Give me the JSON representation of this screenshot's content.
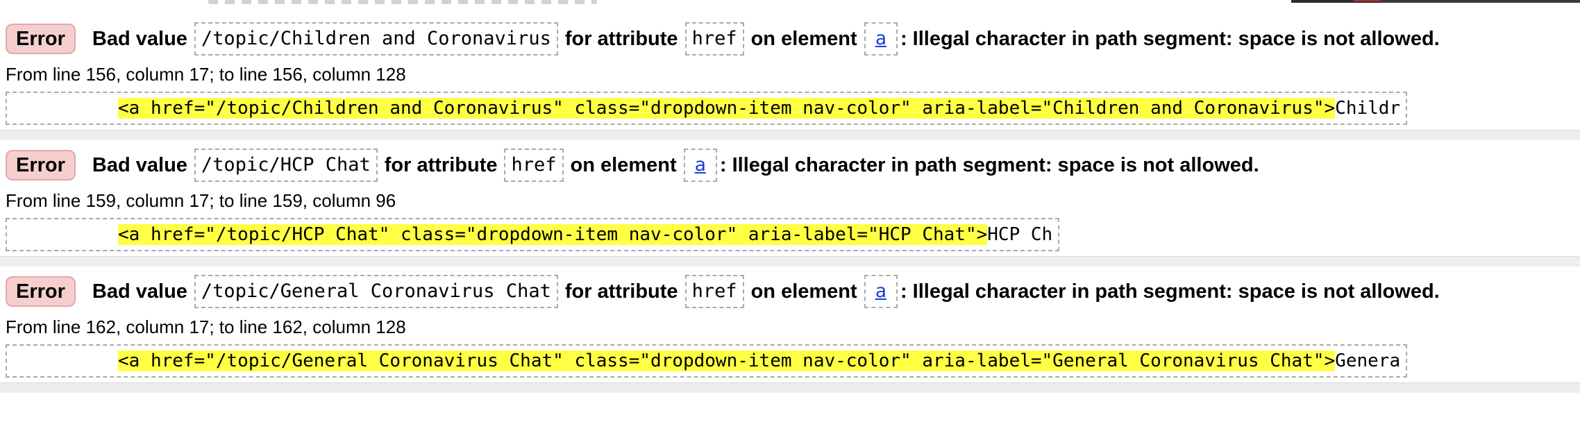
{
  "messages": [
    {
      "type": "Error",
      "part1": "Bad value",
      "value": "/topic/Children and Coronavirus",
      "part2": "for attribute",
      "attribute": "href",
      "part3": "on element",
      "element": "a",
      "part4": ": Illegal character in path segment: space is not allowed.",
      "location": "From line 156, column 17; to line 156, column 128",
      "extract_highlight": "<a href=\"/topic/Children and Coronavirus\" class=\"dropdown-item nav-color\" aria-label=\"Children and Coronavirus\">",
      "extract_tail": "Childr"
    },
    {
      "type": "Error",
      "part1": "Bad value",
      "value": "/topic/HCP Chat",
      "part2": "for attribute",
      "attribute": "href",
      "part3": "on element",
      "element": "a",
      "part4": ": Illegal character in path segment: space is not allowed.",
      "location": "From line 159, column 17; to line 159, column 96",
      "extract_highlight": "<a href=\"/topic/HCP Chat\" class=\"dropdown-item nav-color\" aria-label=\"HCP Chat\">",
      "extract_tail": "HCP Ch"
    },
    {
      "type": "Error",
      "part1": "Bad value",
      "value": "/topic/General Coronavirus Chat",
      "part2": "for attribute",
      "attribute": "href",
      "part3": "on element",
      "element": "a",
      "part4": ": Illegal character in path segment: space is not allowed.",
      "location": "From line 162, column 17; to line 162, column 128",
      "extract_highlight": "<a href=\"/topic/General Coronavirus Chat\" class=\"dropdown-item nav-color\" aria-label=\"General Coronavirus Chat\">",
      "extract_tail": "Genera"
    }
  ],
  "colors": {
    "badge_bg": "#f5cfd0",
    "highlight": "#ffff44",
    "link": "#1a3fd6",
    "separator": "#eeeeee"
  }
}
